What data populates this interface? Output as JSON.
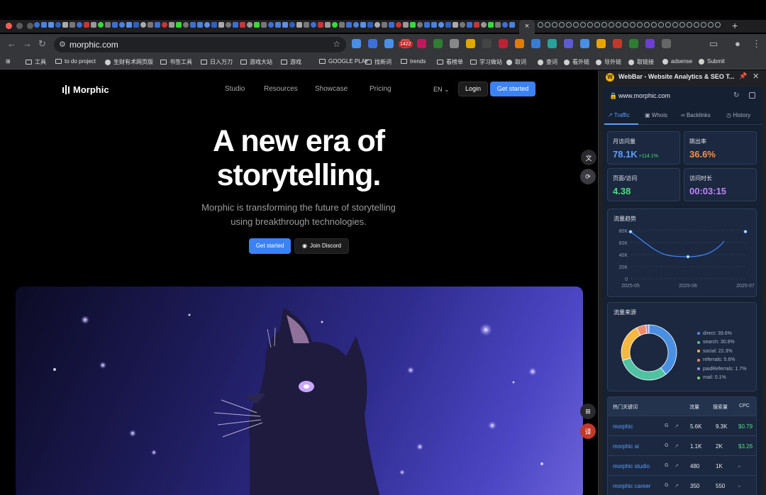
{
  "browser": {
    "url": "morphic.com",
    "extension_badge": "1422",
    "active_tab_close": "×",
    "new_tab": "+",
    "bookmarks": [
      {
        "label": "工具",
        "type": "folder"
      },
      {
        "label": "to do project",
        "type": "folder"
      },
      {
        "label": "生财有术网页版",
        "type": "site"
      },
      {
        "label": "书签工具",
        "type": "folder"
      },
      {
        "label": "日入万刀",
        "type": "folder"
      },
      {
        "label": "游戏大站",
        "type": "folder"
      },
      {
        "label": "游戏",
        "type": "folder"
      },
      {
        "label": "GOOGLE PLAY",
        "type": "folder"
      },
      {
        "label": "找新词",
        "type": "folder"
      },
      {
        "label": "trends",
        "type": "folder"
      },
      {
        "label": "看榜单",
        "type": "folder"
      },
      {
        "label": "学习做站",
        "type": "folder"
      },
      {
        "label": "取词",
        "type": "site"
      },
      {
        "label": "查词",
        "type": "site"
      },
      {
        "label": "看外链",
        "type": "site"
      },
      {
        "label": "导外链",
        "type": "site"
      },
      {
        "label": "取链接",
        "type": "site"
      },
      {
        "label": "adsense",
        "type": "site"
      },
      {
        "label": "Submit",
        "type": "site"
      }
    ]
  },
  "site": {
    "logo": "Morphic",
    "nav": [
      "Studio",
      "Resources",
      "Showcase",
      "Pricing"
    ],
    "lang": "EN",
    "login": "Login",
    "get_started": "Get started",
    "hero_title_1": "A new era of",
    "hero_title_2": "storytelling.",
    "hero_sub_1": "Morphic is transforming the future of storytelling",
    "hero_sub_2": "using breakthrough technologies.",
    "hero_btn_primary": "Get started",
    "hero_btn_secondary": "Join Discord"
  },
  "panel": {
    "title": "WebBar - Website Analytics & SEO T...",
    "domain": "www.morphic.com",
    "tabs": [
      "Traffic",
      "Whois",
      "Backlinks",
      "History"
    ],
    "active_tab": "Traffic",
    "metrics": [
      {
        "label": "月访问量",
        "value": "78.1K",
        "change": "+114.1%",
        "color": "#5aa0ff"
      },
      {
        "label": "跳出率",
        "value": "36.6%",
        "change": "",
        "color": "#fb923c"
      },
      {
        "label": "页面/访问",
        "value": "4.38",
        "change": "",
        "color": "#4ade80"
      },
      {
        "label": "访问时长",
        "value": "00:03:15",
        "change": "",
        "color": "#c084fc"
      }
    ],
    "trend_title": "流量趋势",
    "sources_title": "流量来源",
    "keywords": {
      "title": "热门关键词",
      "columns": [
        "流量",
        "搜索量",
        "CPC"
      ],
      "rows": [
        {
          "keyword": "morphic",
          "traffic": "5.6K",
          "volume": "9.3K",
          "cpc": "$0.79"
        },
        {
          "keyword": "morphic ai",
          "traffic": "1.1K",
          "volume": "2K",
          "cpc": "$3.26"
        },
        {
          "keyword": "morphic studio",
          "traffic": "480",
          "volume": "1K",
          "cpc": "-"
        },
        {
          "keyword": "morphic career",
          "traffic": "350",
          "volume": "550",
          "cpc": "-"
        }
      ]
    }
  },
  "chart_data": [
    {
      "type": "line",
      "title": "流量趋势",
      "x": [
        "2025-05",
        "2025-06",
        "2025-07"
      ],
      "series": [
        {
          "values": [
            78000,
            36500,
            78100
          ]
        }
      ],
      "yticks": [
        "80K",
        "60K",
        "40K",
        "20K",
        "0"
      ],
      "ylim": [
        0,
        80000
      ],
      "color": "#3b82f6"
    },
    {
      "type": "pie",
      "title": "流量来源",
      "labels": [
        "direct",
        "search",
        "social",
        "referrals",
        "paidReferrals",
        "mail"
      ],
      "values": [
        39.6,
        30.8,
        22.3,
        5.6,
        1.7,
        0.1
      ],
      "legend_text": [
        "direct: 39.6%",
        "search: 30.8%",
        "social: 22.3%",
        "referrals: 5.6%",
        "paidReferrals: 1.7%",
        "mail: 0.1%"
      ],
      "colors": [
        "#4a90e2",
        "#4fc3a1",
        "#f5b942",
        "#f08a6b",
        "#9b8fe0",
        "#7ed37e"
      ]
    }
  ]
}
